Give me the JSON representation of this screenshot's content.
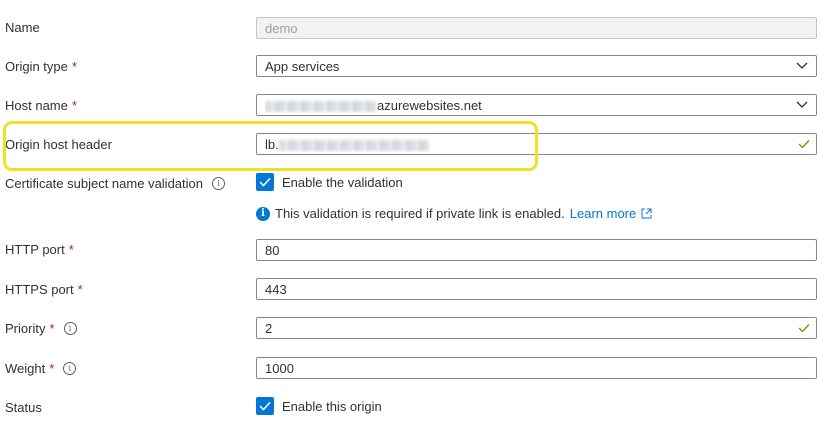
{
  "form": {
    "name": {
      "label": "Name",
      "value": "demo"
    },
    "origin_type": {
      "label": "Origin type",
      "required": "*",
      "value": "App services"
    },
    "host_name": {
      "label": "Host name",
      "required": "*",
      "suffix": "azurewebsites.net"
    },
    "origin_host_header": {
      "label": "Origin host header",
      "prefix": "lb."
    },
    "cert_validation": {
      "label": "Certificate subject name validation",
      "info": "i",
      "checkbox_label": "Enable the validation",
      "checked": true
    },
    "info_message": {
      "text": "This validation is required if private link is enabled.",
      "link": "Learn more"
    },
    "http_port": {
      "label": "HTTP port",
      "required": "*",
      "value": "80"
    },
    "https_port": {
      "label": "HTTPS port",
      "required": "*",
      "value": "443"
    },
    "priority": {
      "label": "Priority",
      "required": "*",
      "info": "i",
      "value": "2"
    },
    "weight": {
      "label": "Weight",
      "required": "*",
      "info": "i",
      "value": "1000"
    },
    "status": {
      "label": "Status",
      "checkbox_label": "Enable this origin",
      "checked": true
    }
  },
  "colors": {
    "accent": "#0078d4",
    "highlight": "#f2e026",
    "valid": "#57a300",
    "required": "#a4262c"
  },
  "icons": [
    "chevron-down-icon",
    "checkmark-icon",
    "info-icon",
    "external-link-icon"
  ]
}
